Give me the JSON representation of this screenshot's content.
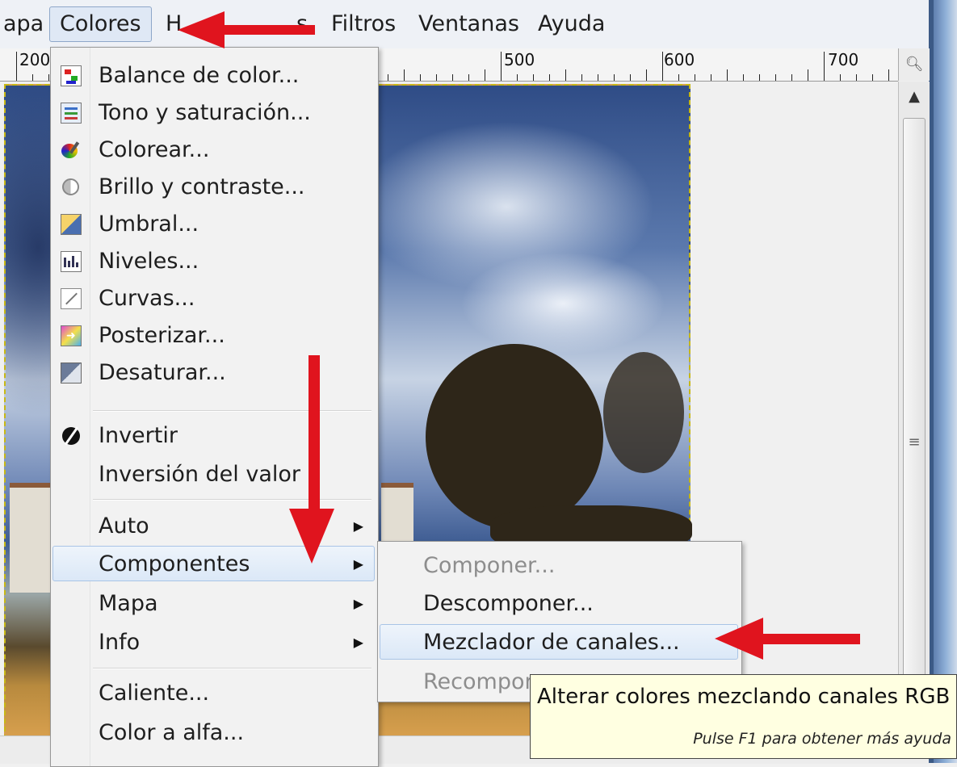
{
  "menubar": {
    "items": [
      {
        "label": "apa"
      },
      {
        "label": "Colores"
      },
      {
        "label": "H"
      },
      {
        "label": "s"
      },
      {
        "label": "Filtros"
      },
      {
        "label": "Ventanas"
      },
      {
        "label": "Ayuda"
      }
    ]
  },
  "ruler": {
    "labels": [
      "200",
      "500",
      "600",
      "700"
    ]
  },
  "colores_menu": {
    "items": [
      {
        "label": "Balance de color...",
        "icon": "color-balance-icon"
      },
      {
        "label": "Tono y saturación...",
        "icon": "hue-saturation-icon"
      },
      {
        "label": "Colorear...",
        "icon": "colorize-icon"
      },
      {
        "label": "Brillo y contraste...",
        "icon": "brightness-contrast-icon"
      },
      {
        "label": "Umbral...",
        "icon": "threshold-icon"
      },
      {
        "label": "Niveles...",
        "icon": "levels-icon"
      },
      {
        "label": "Curvas...",
        "icon": "curves-icon"
      },
      {
        "label": "Posterizar...",
        "icon": "posterize-icon"
      },
      {
        "label": "Desaturar...",
        "icon": "desaturate-icon"
      },
      {
        "label": "Invertir",
        "icon": "invert-icon"
      },
      {
        "label": "Inversión del valor"
      },
      {
        "label": "Auto"
      },
      {
        "label": "Componentes"
      },
      {
        "label": "Mapa"
      },
      {
        "label": "Info"
      },
      {
        "label": "Caliente..."
      },
      {
        "label": "Color a alfa..."
      }
    ]
  },
  "componentes_menu": {
    "items": [
      {
        "label": "Componer...",
        "disabled": true
      },
      {
        "label": "Descomponer...",
        "disabled": false
      },
      {
        "label": "Mezclador de canales...",
        "disabled": false
      },
      {
        "label": "Recompon",
        "disabled": true
      }
    ]
  },
  "tooltip": {
    "text": "Alterar colores mezclando canales RGB",
    "hint": "Pulse F1 para obtener más ayuda"
  },
  "colors": {
    "annotation_arrow": "#e0141e",
    "highlight_border": "#a9c4e6",
    "tooltip_bg": "#ffffe1"
  }
}
